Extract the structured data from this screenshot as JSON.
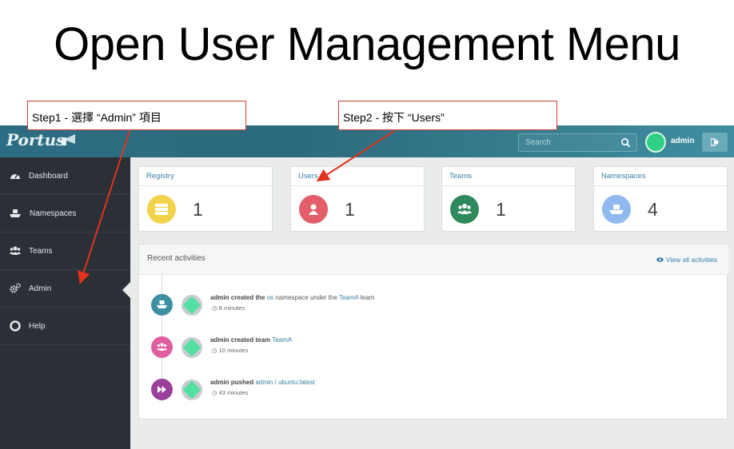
{
  "slide": {
    "title": "Open User Management Menu"
  },
  "callouts": [
    {
      "text": "Step1 - 選擇 “Admin” 項目"
    },
    {
      "text": "Step2 - 按下 “Users”"
    }
  ],
  "topbar": {
    "logo": "Portus",
    "search_placeholder": "Search",
    "username": "admin"
  },
  "sidebar": {
    "items": [
      {
        "label": "Dashboard",
        "icon": "dashboard-icon"
      },
      {
        "label": "Namespaces",
        "icon": "ship-icon"
      },
      {
        "label": "Teams",
        "icon": "users-icon"
      },
      {
        "label": "Admin",
        "icon": "cogs-icon"
      },
      {
        "label": "Help",
        "icon": "lifebuoy-icon"
      }
    ],
    "active": "Admin"
  },
  "cards": [
    {
      "label": "Registry",
      "count": "1",
      "color": "#f2d24b",
      "icon": "server-icon"
    },
    {
      "label": "Users",
      "count": "1",
      "color": "#e35d6a",
      "icon": "user-icon"
    },
    {
      "label": "Teams",
      "count": "1",
      "color": "#2e8a5c",
      "icon": "users-icon"
    },
    {
      "label": "Namespaces",
      "count": "4",
      "color": "#8fb9ef",
      "icon": "ship-icon"
    }
  ],
  "activity": {
    "title": "Recent activities",
    "view_all": "View all activities",
    "items": [
      {
        "icon_color": "#3d8fa3",
        "icon": "ship-icon",
        "actor": "admin created the",
        "link1": "os",
        "middle": "namespace under the",
        "link2": "TeamA",
        "tail": "team",
        "time": "8 minutes"
      },
      {
        "icon_color": "#e25d9d",
        "icon": "users-icon",
        "actor": "admin created team",
        "link1": "TeamA",
        "time": "10 minutes"
      },
      {
        "icon_color": "#9b3f9c",
        "icon": "forward-icon",
        "actor": "admin pushed",
        "link1": "admin",
        "sep": "/",
        "link2": "ubuntu:latest",
        "time": "43 minutes"
      }
    ]
  }
}
